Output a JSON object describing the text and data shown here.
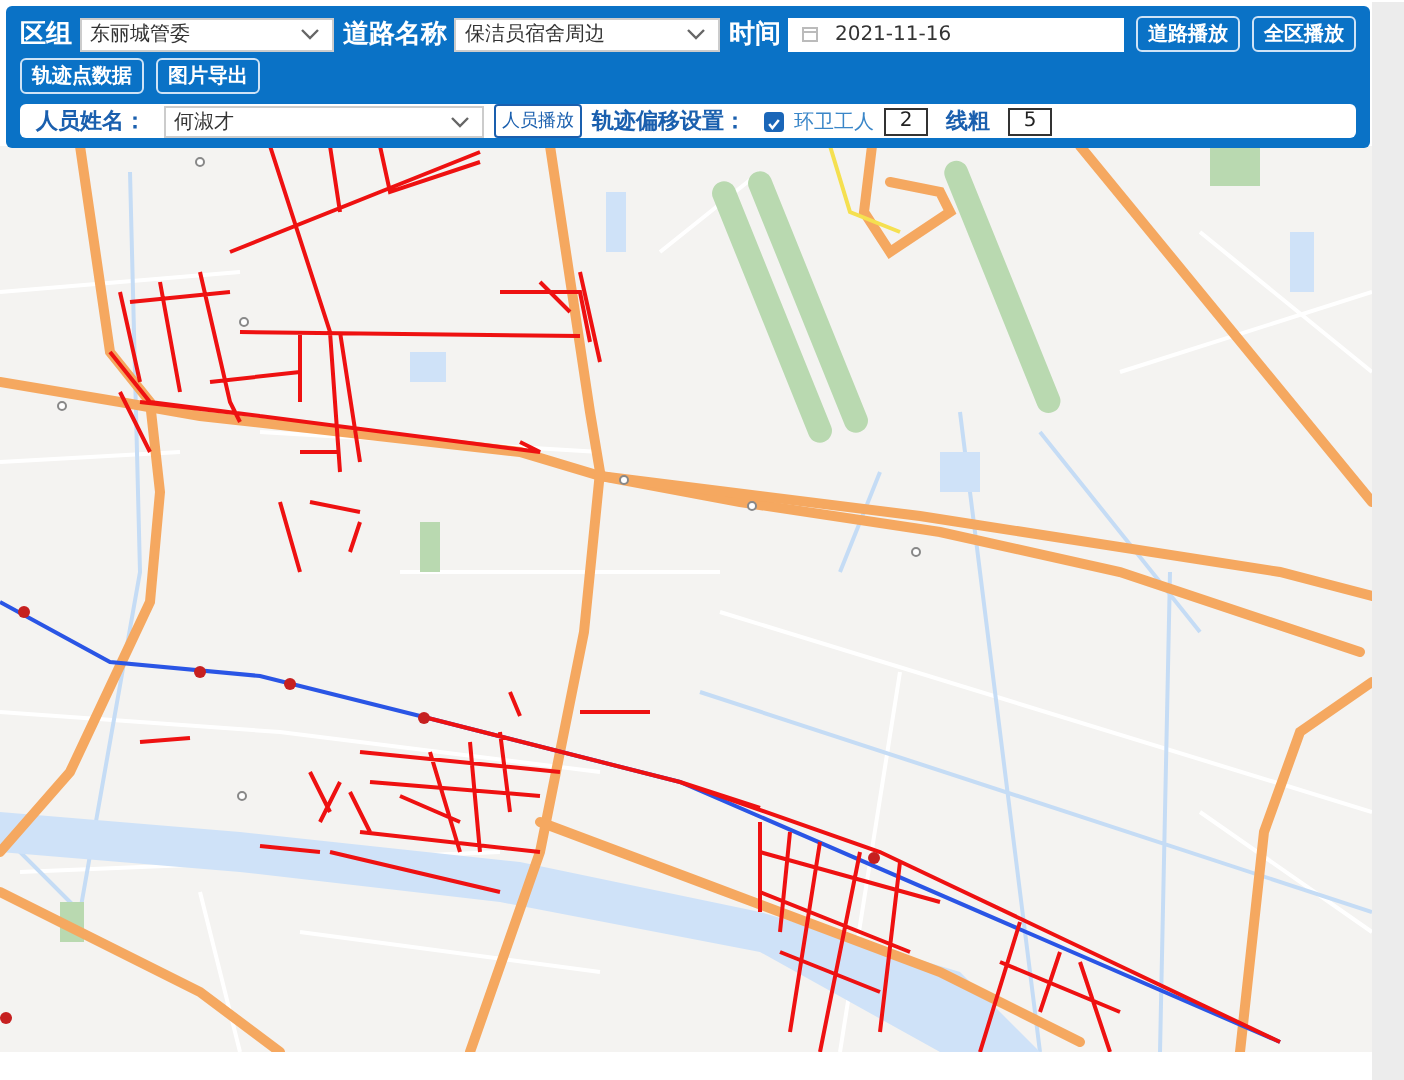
{
  "toolbar": {
    "district": {
      "label": "区组",
      "value": "东丽城管委"
    },
    "road": {
      "label": "道路名称",
      "value": "保洁员宿舍周边"
    },
    "time": {
      "label": "时间",
      "value": "2021-11-16"
    },
    "buttons": [
      "道路播放",
      "全区播放"
    ],
    "second_row_buttons": [
      "轨迹点数据",
      "图片导出"
    ]
  },
  "person_panel": {
    "name_label": "人员姓名：",
    "name_value": "何淑才",
    "play_button": "人员播放",
    "offset_label": "轨迹偏移设置：",
    "worker_option": {
      "label": "环卫工人",
      "checked": true,
      "value": "2"
    },
    "line_width": {
      "label": "线粗",
      "value": "5"
    }
  }
}
